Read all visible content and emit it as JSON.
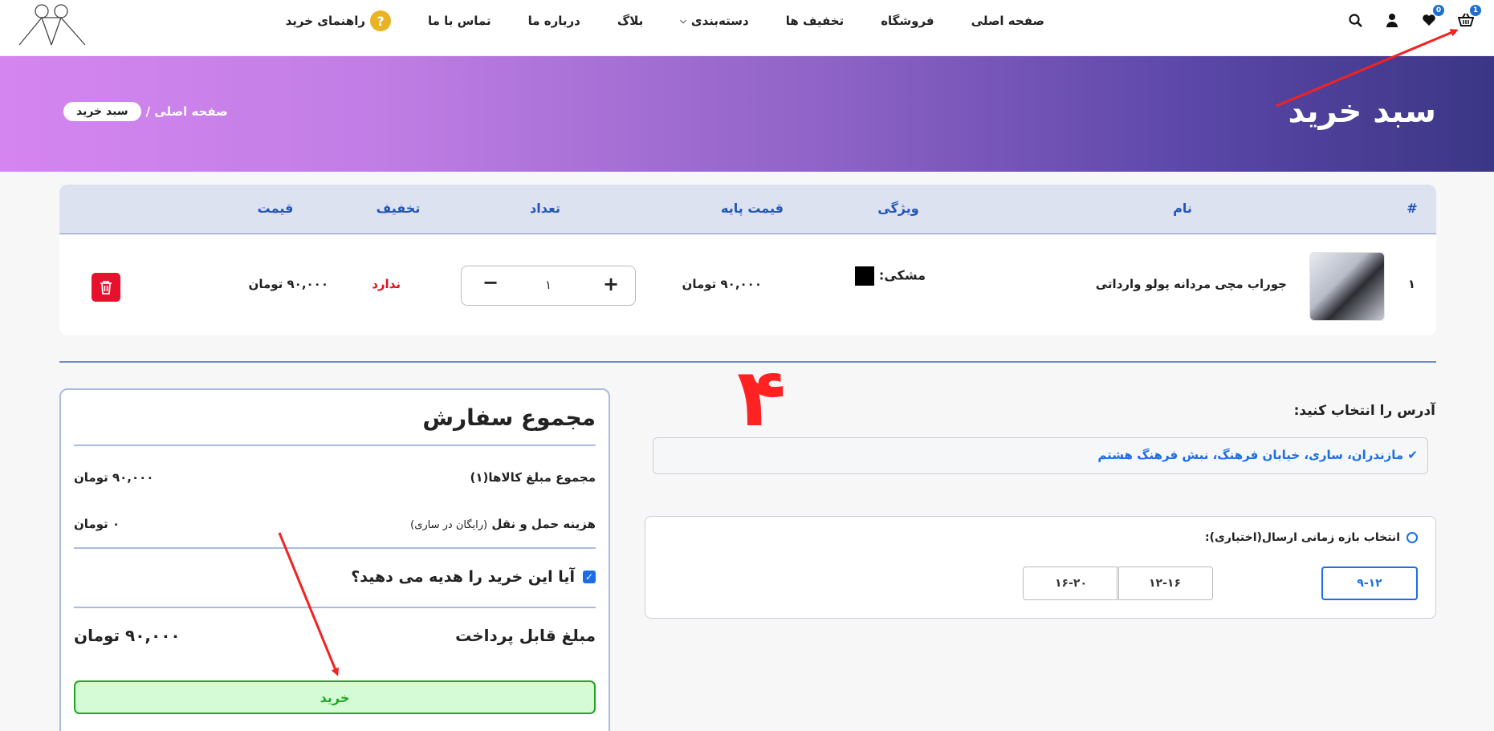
{
  "header": {
    "nav": [
      {
        "label": "صفحه اصلی"
      },
      {
        "label": "فروشگاه"
      },
      {
        "label": "تخفیف ها"
      },
      {
        "label": "دسته‌بندی"
      },
      {
        "label": "بلاگ"
      },
      {
        "label": "درباره ما"
      },
      {
        "label": "تماس با ما"
      },
      {
        "label": "راهنمای خرید"
      }
    ],
    "help_glyph": "?",
    "cart_badge": "1",
    "wishlist_badge": "0",
    "icons": [
      "cart-icon",
      "heart-icon",
      "user-icon",
      "search-icon"
    ]
  },
  "hero": {
    "title": "سبد خرید",
    "breadcrumb_home": "صفحه اصلی /",
    "breadcrumb_current": "سبد خرید"
  },
  "table": {
    "headers": {
      "index": "#",
      "name": "نام",
      "feature": "ویژگی",
      "base_price": "قیمت پایه",
      "quantity": "تعداد",
      "discount": "تخفیف",
      "price": "قیمت"
    },
    "rows": [
      {
        "index": "۱",
        "name": "جوراب مچی مردانه پولو وارداتی",
        "feature": "مشکی:",
        "swatch_color": "#000000",
        "base_price": "۹۰,۰۰۰ تومان",
        "quantity": "۱",
        "discount": "ندارد",
        "price": "۹۰,۰۰۰ تومان"
      }
    ],
    "plus": "+",
    "minus": "−"
  },
  "summary": {
    "title": "مجموع سفارش",
    "items_label": "مجموع مبلغ کالاها(۱)",
    "items_value": "۹۰,۰۰۰ تومان",
    "shipping_label": "هزینه حمل و نقل",
    "shipping_note": "(رایگان در ساری)",
    "shipping_value": "۰ تومان",
    "gift_label": "آیا این خرید را هدیه می دهید؟",
    "gift_checked": true,
    "payable_label": "مبلغ قابل پرداخت",
    "payable_value": "۹۰,۰۰۰ تومان",
    "buy_label": "خرید"
  },
  "address": {
    "label": "آدرس را انتخاب کنید:",
    "selected": "✔ مازندران، ساری، خیابان فرهنگ، نبش فرهنگ هشتم"
  },
  "delivery": {
    "label": "انتخاب بازه زمانی ارسال(اختیاری):",
    "slots": [
      "۹-۱۲",
      "۱۲-۱۶",
      "۱۶-۲۰"
    ],
    "active_slot": "۹-۱۲"
  },
  "annotation": {
    "number": "۴",
    "color": "#f22222"
  },
  "colors": {
    "accent_blue": "#2155b7",
    "delete_red": "#e8112d",
    "buy_green": "#1ea81e"
  }
}
